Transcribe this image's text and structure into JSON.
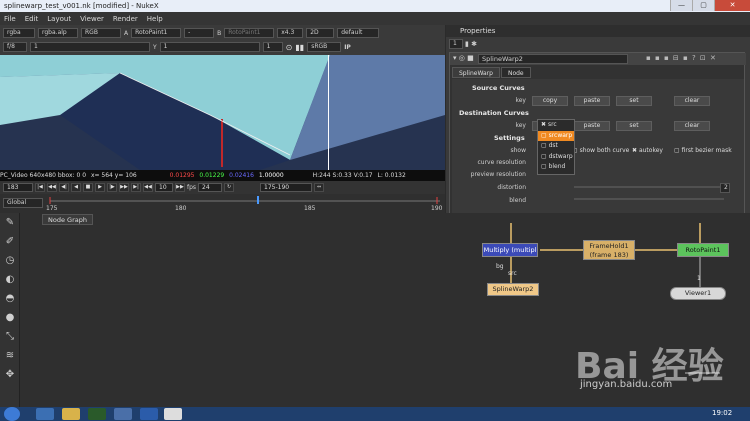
{
  "window": {
    "title": "splinewarp_test_v001.nk [modified] - NukeX",
    "buttons": [
      "—",
      "▢",
      "✕"
    ]
  },
  "menu": [
    "File",
    "Edit",
    "Layout",
    "Viewer",
    "Render",
    "Help"
  ],
  "toolbar": {
    "row1": [
      "rgba",
      "rgba.alp",
      "RGB",
      "A",
      "RotoPaint1",
      "-",
      "B",
      "RotoPaint1",
      "x4.3",
      "2D",
      "default"
    ],
    "row2_left": [
      "f/8",
      "1",
      "Y",
      "1",
      "1",
      "sRGB",
      "IP"
    ]
  },
  "status": {
    "info": "PC_Video 640x480 bbox: 0 0",
    "coords": "x= 564 y= 106",
    "r": "0.01295",
    "g": "0.01229",
    "b": "0.02416",
    "a": "1.00000",
    "hsv": "H:244 S:0.33 V:0.17",
    "l": "L: 0.0132"
  },
  "playbar": {
    "frame": "183",
    "step": "10",
    "fps_label": "fps",
    "fps": "24",
    "range": "175-190"
  },
  "timeline": {
    "mode": "Global",
    "ticks": [
      "175",
      "180",
      "185",
      "190"
    ]
  },
  "properties": {
    "header": "Properties",
    "node_name": "SplineWarp2",
    "tabs": [
      "SplineWarp",
      "Node"
    ],
    "source_curves": "Source Curves",
    "dest_curves": "Destination Curves",
    "settings": "Settings",
    "key_label": "key",
    "buttons": [
      "copy",
      "paste",
      "set",
      "clear"
    ],
    "show_label": "show",
    "curve_res_label": "curve resolution",
    "preview_res_label": "preview resolution",
    "distortion_label": "distortion",
    "blend_label": "blend",
    "show_both": "show both curve",
    "autokey": "autokey",
    "first_bezier": "first bezier mask",
    "dropdown": [
      "src",
      "srcwarp",
      "dst",
      "dstwarp",
      "blend"
    ],
    "distortion_value": "2"
  },
  "sidebar": [
    "pencil-icon",
    "brush-icon",
    "clock-icon",
    "palette-icon",
    "droplet-icon",
    "sphere-icon",
    "bezier-icon",
    "layers-icon",
    "move-icon"
  ],
  "node_graph": {
    "tab": "Node Graph",
    "nodes": {
      "multiply": "Multiply (multipl",
      "framehold_1": "FrameHold1",
      "framehold_2": "(frame 183)",
      "rotopaint": "RotoPaint1",
      "splinewarp": "SplineWarp2",
      "viewer": "Viewer1"
    },
    "labels": {
      "bg": "bg",
      "src": "src",
      "one": "1"
    },
    "watermark": "Bai 经验",
    "watermark_url": "jingyan.baidu.com"
  },
  "taskbar": {
    "time": "19:02"
  }
}
